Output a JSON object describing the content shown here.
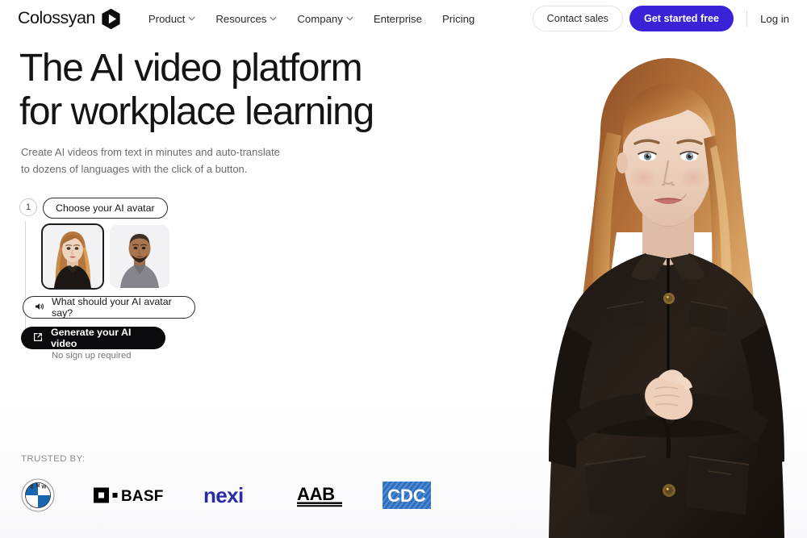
{
  "brand": {
    "name": "Colossyan",
    "mark_icon": "play-hexagon-icon"
  },
  "nav": {
    "items": [
      {
        "label": "Product",
        "has_dropdown": true,
        "icon": "chevron-down-icon"
      },
      {
        "label": "Resources",
        "has_dropdown": true,
        "icon": "chevron-down-icon"
      },
      {
        "label": "Company",
        "has_dropdown": true,
        "icon": "chevron-down-icon"
      },
      {
        "label": "Enterprise",
        "has_dropdown": false,
        "icon": ""
      },
      {
        "label": "Pricing",
        "has_dropdown": false,
        "icon": ""
      }
    ]
  },
  "header_actions": {
    "contact_sales": "Contact sales",
    "get_started": "Get started free",
    "login": "Log in",
    "accent_color": "#3a22d6"
  },
  "hero": {
    "headline_line1": "The AI video platform",
    "headline_line2": "for workplace learning",
    "subhead_line1": "Create AI videos from text in minutes and auto-translate",
    "subhead_line2": "to dozens of languages with the click of a button.",
    "portrait_alt": "AI avatar presenter, woman with long reddish-blonde hair in a dark jacket, hands clasped"
  },
  "widget": {
    "step_number": "1",
    "step_label": "Choose your AI avatar",
    "avatars": [
      {
        "name": "avatar-option-woman",
        "selected": true,
        "alt": "Woman with long reddish-blonde hair, dark top"
      },
      {
        "name": "avatar-option-man",
        "selected": false,
        "alt": "Bald man with beard, gray v-neck shirt"
      }
    ],
    "say_placeholder": "What should your AI avatar say?",
    "say_icon": "speaker-icon",
    "generate_label": "Generate your AI video",
    "generate_icon": "external-link-icon",
    "no_signup_note": "No sign up required"
  },
  "trusted": {
    "label": "TRUSTED BY:",
    "logos": [
      {
        "name": "bmw-logo",
        "text": "BMW",
        "color": "#1666b0"
      },
      {
        "name": "basf-logo",
        "text": "BASF",
        "color": "#000000"
      },
      {
        "name": "nexi-logo",
        "text": "nexi",
        "color": "#2a2aa5"
      },
      {
        "name": "aab-logo",
        "text": "AAB",
        "color": "#000000"
      },
      {
        "name": "cdc-logo",
        "text": "CDC",
        "color": "#2f6fbf"
      }
    ]
  }
}
